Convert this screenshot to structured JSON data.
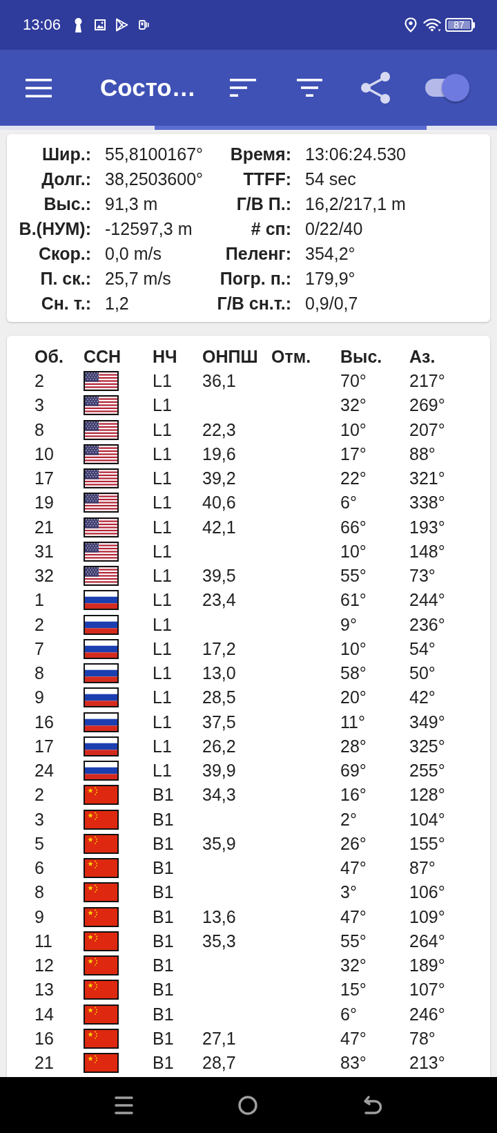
{
  "status_bar": {
    "time": "13:06",
    "battery": "87"
  },
  "toolbar": {
    "title": "Состо…",
    "switch": {
      "on": true
    }
  },
  "position": {
    "fields": [
      {
        "label": "Шир.:",
        "value": "55,8100167°"
      },
      {
        "label": "Время:",
        "value": "13:06:24.530"
      },
      {
        "label": "Долг.:",
        "value": "38,2503600°"
      },
      {
        "label": "TTFF:",
        "value": "54 sec"
      },
      {
        "label": "Выс.:",
        "value": "91,3 m"
      },
      {
        "label": "Г/В П.:",
        "value": "16,2/217,1 m"
      },
      {
        "label": "В.(НУМ):",
        "value": "-12597,3 m"
      },
      {
        "label": "# сп:",
        "value": "0/22/40"
      },
      {
        "label": "Скор.:",
        "value": "0,0 m/s"
      },
      {
        "label": "Пеленг:",
        "value": "354,2°"
      },
      {
        "label": "П. ск.:",
        "value": "25,7 m/s"
      },
      {
        "label": "Погр. п.:",
        "value": "179,9°"
      },
      {
        "label": "Сн. т.:",
        "value": "1,2"
      },
      {
        "label": "Г/В сн.т.:",
        "value": "0,9/0,7"
      }
    ]
  },
  "satellites": {
    "columns": [
      "Об.",
      "ССН",
      "НЧ",
      "ОНПШ",
      "Отм.",
      "Выс.",
      "Аз."
    ],
    "rows": [
      {
        "id": "2",
        "kind": "us",
        "band": "L1",
        "snr": "36,1",
        "elevation": "70°",
        "azimuth": "217°"
      },
      {
        "id": "3",
        "kind": "us",
        "band": "L1",
        "elevation": "32°",
        "azimuth": "269°"
      },
      {
        "id": "8",
        "kind": "us",
        "band": "L1",
        "snr": "22,3",
        "elevation": "10°",
        "azimuth": "207°"
      },
      {
        "id": "10",
        "kind": "us",
        "band": "L1",
        "snr": "19,6",
        "elevation": "17°",
        "azimuth": "88°"
      },
      {
        "id": "17",
        "kind": "us",
        "band": "L1",
        "snr": "39,2",
        "elevation": "22°",
        "azimuth": "321°"
      },
      {
        "id": "19",
        "kind": "us",
        "band": "L1",
        "snr": "40,6",
        "elevation": "6°",
        "azimuth": "338°"
      },
      {
        "id": "21",
        "kind": "us",
        "band": "L1",
        "snr": "42,1",
        "elevation": "66°",
        "azimuth": "193°"
      },
      {
        "id": "31",
        "kind": "us",
        "band": "L1",
        "elevation": "10°",
        "azimuth": "148°"
      },
      {
        "id": "32",
        "kind": "us",
        "band": "L1",
        "snr": "39,5",
        "elevation": "55°",
        "azimuth": "73°"
      },
      {
        "id": "1",
        "kind": "ru",
        "band": "L1",
        "snr": "23,4",
        "elevation": "61°",
        "azimuth": "244°"
      },
      {
        "id": "2",
        "kind": "ru",
        "band": "L1",
        "elevation": "9°",
        "azimuth": "236°"
      },
      {
        "id": "7",
        "kind": "ru",
        "band": "L1",
        "snr": "17,2",
        "elevation": "10°",
        "azimuth": "54°"
      },
      {
        "id": "8",
        "kind": "ru",
        "band": "L1",
        "snr": "13,0",
        "elevation": "58°",
        "azimuth": "50°"
      },
      {
        "id": "9",
        "kind": "ru",
        "band": "L1",
        "snr": "28,5",
        "elevation": "20°",
        "azimuth": "42°"
      },
      {
        "id": "16",
        "kind": "ru",
        "band": "L1",
        "snr": "37,5",
        "elevation": "11°",
        "azimuth": "349°"
      },
      {
        "id": "17",
        "kind": "ru",
        "band": "L1",
        "snr": "26,2",
        "elevation": "28°",
        "azimuth": "325°"
      },
      {
        "id": "24",
        "kind": "ru",
        "band": "L1",
        "snr": "39,9",
        "elevation": "69°",
        "azimuth": "255°"
      },
      {
        "id": "2",
        "kind": "cn",
        "band": "B1",
        "snr": "34,3",
        "elevation": "16°",
        "azimuth": "128°"
      },
      {
        "id": "3",
        "kind": "cn",
        "band": "B1",
        "elevation": "2°",
        "azimuth": "104°"
      },
      {
        "id": "5",
        "kind": "cn",
        "band": "B1",
        "snr": "35,9",
        "elevation": "26°",
        "azimuth": "155°"
      },
      {
        "id": "6",
        "kind": "cn",
        "band": "B1",
        "elevation": "47°",
        "azimuth": "87°"
      },
      {
        "id": "8",
        "kind": "cn",
        "band": "B1",
        "elevation": "3°",
        "azimuth": "106°"
      },
      {
        "id": "9",
        "kind": "cn",
        "band": "B1",
        "snr": "13,6",
        "elevation": "47°",
        "azimuth": "109°"
      },
      {
        "id": "11",
        "kind": "cn",
        "band": "B1",
        "snr": "35,3",
        "elevation": "55°",
        "azimuth": "264°"
      },
      {
        "id": "12",
        "kind": "cn",
        "band": "B1",
        "elevation": "32°",
        "azimuth": "189°"
      },
      {
        "id": "13",
        "kind": "cn",
        "band": "B1",
        "elevation": "15°",
        "azimuth": "107°"
      },
      {
        "id": "14",
        "kind": "cn",
        "band": "B1",
        "elevation": "6°",
        "azimuth": "246°"
      },
      {
        "id": "16",
        "kind": "cn",
        "band": "B1",
        "snr": "27,1",
        "elevation": "47°",
        "azimuth": "78°"
      },
      {
        "id": "21",
        "kind": "cn",
        "band": "B1",
        "snr": "28,7",
        "elevation": "83°",
        "azimuth": "213°"
      }
    ]
  }
}
